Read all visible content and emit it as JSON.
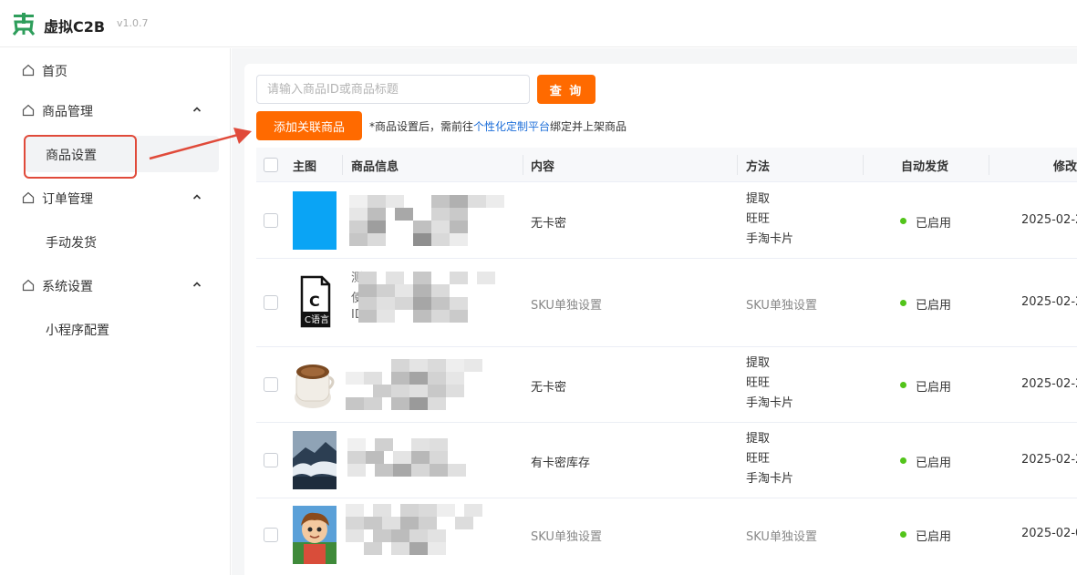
{
  "app": {
    "title": "虚拟C2B",
    "version": "v1.0.7"
  },
  "sidebar": {
    "items": [
      {
        "label": "首页"
      },
      {
        "label": "商品管理",
        "children": [
          {
            "label": "商品设置"
          }
        ]
      },
      {
        "label": "订单管理",
        "children": [
          {
            "label": "手动发货"
          }
        ]
      },
      {
        "label": "系统设置",
        "children": [
          {
            "label": "小程序配置"
          }
        ]
      }
    ]
  },
  "toolbar": {
    "search_placeholder": "请输入商品ID或商品标题",
    "query_label": "查 询",
    "add_label": "添加关联商品",
    "tip_prefix": "*商品设置后，需前往",
    "tip_link": "个性化定制平台",
    "tip_suffix": "绑定并上架商品"
  },
  "table": {
    "headers": [
      "主图",
      "商品信息",
      "内容",
      "方法",
      "自动发货",
      "修改"
    ],
    "rows": [
      {
        "content": "无卡密",
        "methods": [
          "提取",
          "旺旺",
          "手淘卡片"
        ],
        "status": "已启用",
        "modified": "2025-02-2",
        "thumb": "blue-image"
      },
      {
        "content": "SKU单独设置",
        "methods": [
          "SKU单独设置"
        ],
        "status": "已启用",
        "modified": "2025-02-2",
        "thumb": "c-language-file-icon",
        "thumb_label": "C语言",
        "info_fragments": [
          "测",
          "使",
          "ID"
        ]
      },
      {
        "content": "无卡密",
        "methods": [
          "提取",
          "旺旺",
          "手淘卡片"
        ],
        "status": "已启用",
        "modified": "2025-02-2",
        "thumb": "coffee-cup-image"
      },
      {
        "content": "有卡密库存",
        "methods": [
          "提取",
          "旺旺",
          "手淘卡片"
        ],
        "status": "已启用",
        "modified": "2025-02-2",
        "thumb": "mountain-clouds-image"
      },
      {
        "content": "SKU单独设置",
        "methods": [
          "SKU单独设置"
        ],
        "status": "已启用",
        "modified": "2025-02-0",
        "thumb": "cartoon-boy-image"
      }
    ]
  },
  "colors": {
    "accent": "#ff6a00",
    "link": "#1e6fd9",
    "status_ok": "#52c41a",
    "annotation": "#e04a3a"
  }
}
